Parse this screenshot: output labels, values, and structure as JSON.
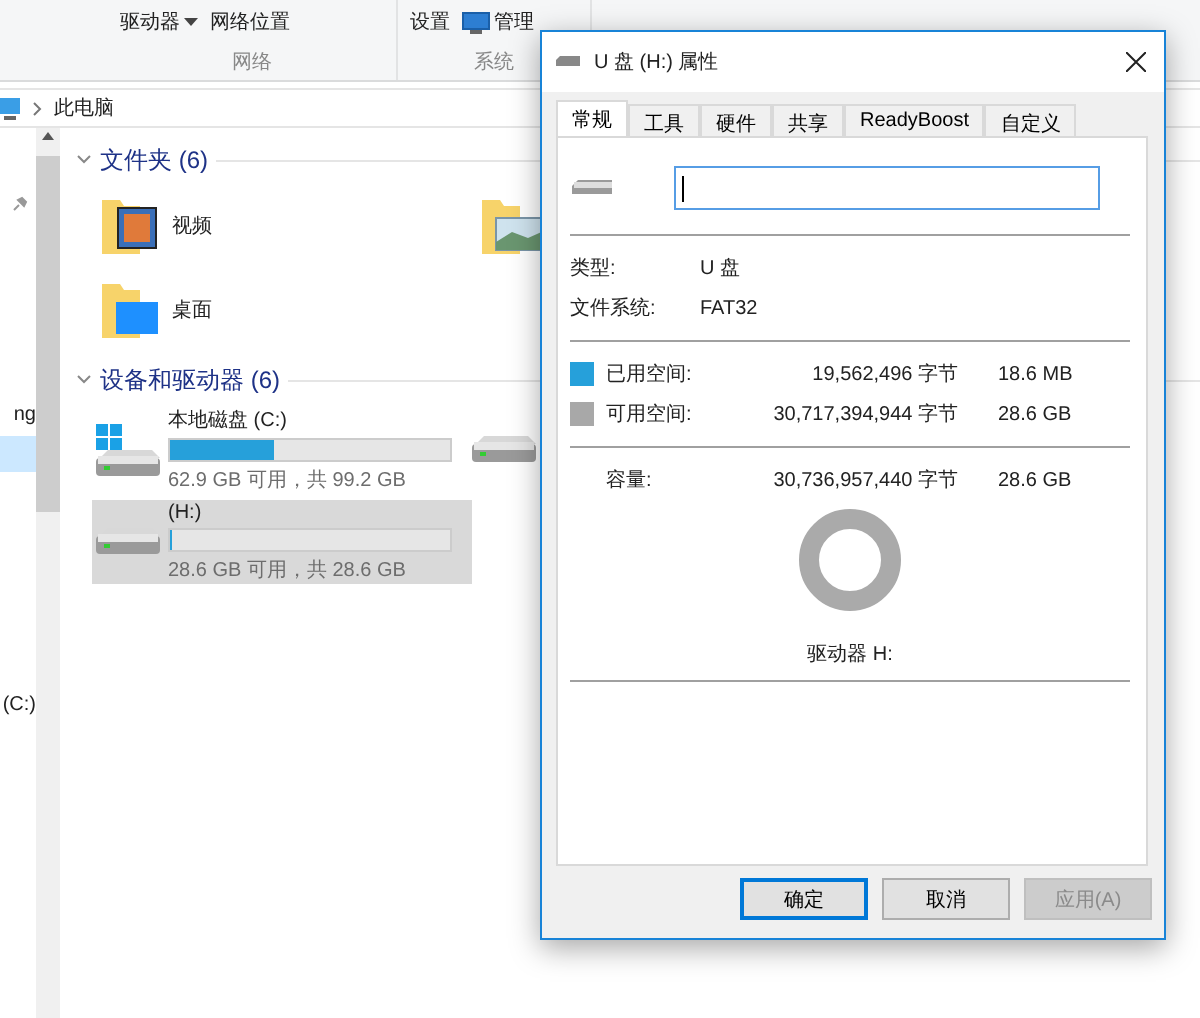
{
  "ribbon": {
    "groups": [
      {
        "label": "网络",
        "items": [
          {
            "label": "驱动器",
            "kind": "dropdown"
          },
          {
            "label": "网络位置",
            "kind": "plain"
          }
        ]
      },
      {
        "label": "系统",
        "items": [
          {
            "label": "设置",
            "kind": "plain"
          },
          {
            "label": "管理",
            "kind": "icon"
          }
        ]
      }
    ]
  },
  "address_bar": {
    "path": [
      "此电脑"
    ]
  },
  "nav_pane": {
    "items": [
      {
        "label": "ng",
        "selected": false
      },
      {
        "selected": true
      },
      {
        "label": "(C:)",
        "selected": false
      }
    ]
  },
  "sections": [
    {
      "title": "文件夹 (6)",
      "kind": "folders",
      "expanded": true,
      "items": [
        {
          "label": "视频",
          "kind": "video"
        },
        {
          "kind": "pictures"
        },
        {
          "label": "桌面",
          "kind": "desktop"
        }
      ]
    },
    {
      "title": "设备和驱动器 (6)",
      "kind": "drives",
      "expanded": true,
      "items": [
        {
          "label": "本地磁盘 (C:)",
          "kind": "system",
          "level": 0.37,
          "detail": "62.9 GB 可用，共 99.2 GB",
          "selected": false
        },
        {
          "kind": "drive",
          "selected": false
        },
        {
          "label": "(H:)",
          "kind": "drive",
          "level": 0.001,
          "detail": "28.6 GB 可用，共 28.6 GB",
          "selected": true
        }
      ]
    }
  ],
  "dialog": {
    "title": "U 盘 (H:) 属性",
    "tabs": [
      {
        "label": "常规",
        "selected": true
      },
      {
        "label": "工具",
        "selected": false
      },
      {
        "label": "硬件",
        "selected": false
      },
      {
        "label": "共享",
        "selected": false
      },
      {
        "label": "ReadyBoost",
        "selected": false
      },
      {
        "label": "自定义",
        "selected": false
      }
    ],
    "properties": [
      {
        "label": "类型:",
        "value": "U 盘"
      },
      {
        "label": "文件系统:",
        "value": "FAT32"
      }
    ],
    "space": [
      {
        "label": "已用空间:",
        "bytes": "19,562,496 字节",
        "size": "18.6 MB",
        "color": "#26a0da"
      },
      {
        "label": "可用空间:",
        "bytes": "30,717,394,944 字节",
        "size": "28.6 GB",
        "color": "#a8a8a8"
      }
    ],
    "capacity": {
      "label": "容量:",
      "bytes": "30,736,957,440 字节",
      "size": "28.6 GB"
    },
    "drive_label": "驱动器 H:",
    "buttons": [
      {
        "label": "确定",
        "kind": "default",
        "disabled": false
      },
      {
        "label": "取消",
        "kind": "normal",
        "disabled": false
      },
      {
        "label": "应用(A)",
        "kind": "normal",
        "disabled": true
      }
    ]
  }
}
